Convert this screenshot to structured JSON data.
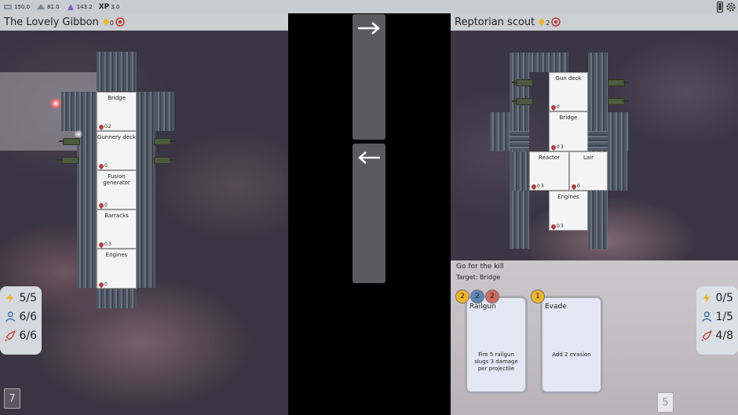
{
  "topbar": {
    "res1_value": "150.0",
    "res2_value": "81.0",
    "res3_value": "143.2",
    "xp_label": "XP",
    "xp_value": "3.0"
  },
  "player_ship": {
    "name": "The Lovely Gibbon",
    "evasion_value": "0",
    "rooms": [
      {
        "name": "Bridge",
        "hp": "0",
        "crew": "2"
      },
      {
        "name": "Gunnery deck",
        "hp": "0",
        "crew": ""
      },
      {
        "name": "Fusion generator",
        "hp": "0",
        "crew": ""
      },
      {
        "name": "Barracks",
        "hp": "0",
        "crew": "3"
      },
      {
        "name": "Engines",
        "hp": "0",
        "crew": ""
      }
    ],
    "stats": {
      "energy": "5/5",
      "crew": "6/6",
      "missiles": "6/6"
    },
    "turn_counter": "7"
  },
  "enemy_ship": {
    "name": "Reptorian scout",
    "evasion_value": "2",
    "rooms": [
      {
        "name": "Gun deck",
        "hp": "0",
        "crew": ""
      },
      {
        "name": "Bridge",
        "hp": "0",
        "crew": "3"
      },
      {
        "name": "Reactor",
        "hp": "0",
        "crew": "3"
      },
      {
        "name": "Lair",
        "hp": "0",
        "crew": ""
      },
      {
        "name": "Engines",
        "hp": "0",
        "crew": "3"
      }
    ],
    "stats": {
      "energy": "0/5",
      "crew": "1/5",
      "missiles": "4/8"
    },
    "turn_counter": "5"
  },
  "action": {
    "title": "Go for the kill",
    "target": "Target: Bridge",
    "cards": [
      {
        "name": "Railgun",
        "desc": "Fire 5 railgun slugs 3 damage per projectile",
        "cost_energy": "2",
        "cost_crew": "2",
        "cost_missile": "2"
      },
      {
        "name": "Evade",
        "desc": "Add 2 evasion",
        "cost_energy": "1"
      }
    ]
  },
  "colors": {
    "energy": "#f0b429",
    "crew": "#3a6ea5",
    "missile": "#c0392b",
    "panel_bg": "#d7dade",
    "card_bg": "#e4e6f4"
  },
  "icons": [
    "energy-icon",
    "crew-icon",
    "missile-icon",
    "heart-icon",
    "evasion-icon",
    "arrow-right-icon",
    "arrow-left-icon",
    "settings-icon",
    "phone-icon"
  ]
}
